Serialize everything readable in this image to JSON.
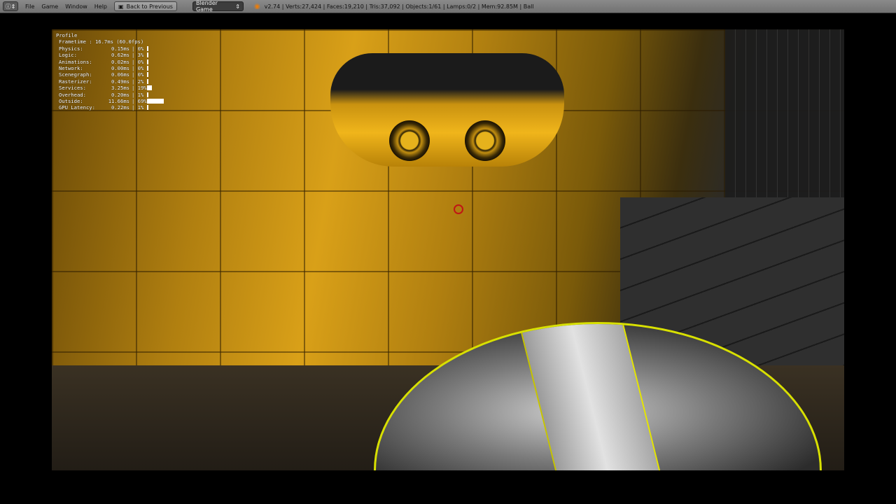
{
  "topbar": {
    "editor_icon": "info-icon",
    "menus": [
      "File",
      "Game",
      "Window",
      "Help"
    ],
    "back_button": "Back to Previous",
    "scene_engine": "Blender Game",
    "stats": "v2.74 | Verts:27,424 | Faces:19,210 | Tris:37,092 | Objects:1/61 | Lamps:0/2 | Mem:92.85M | Ball"
  },
  "profile": {
    "title": "Profile",
    "frametime_label": "Frametime :",
    "frametime_value": "16.7ms (60.0fps)",
    "rows": [
      {
        "label": "Physics:",
        "ms": "0.15ms",
        "pct": "| 0%",
        "fraction": 0.0
      },
      {
        "label": "Logic:",
        "ms": "0.62ms",
        "pct": "| 3%",
        "fraction": 0.03
      },
      {
        "label": "Animations:",
        "ms": "0.02ms",
        "pct": "| 0%",
        "fraction": 0.0
      },
      {
        "label": "Network:",
        "ms": "0.00ms",
        "pct": "| 0%",
        "fraction": 0.0
      },
      {
        "label": "Scenegraph:",
        "ms": "0.06ms",
        "pct": "| 0%",
        "fraction": 0.0
      },
      {
        "label": "Rasterizer:",
        "ms": "0.49ms",
        "pct": "| 2%",
        "fraction": 0.02
      },
      {
        "label": "Services:",
        "ms": "3.25ms",
        "pct": "| 19%",
        "fraction": 0.19
      },
      {
        "label": "Overhead:",
        "ms": "0.20ms",
        "pct": "| 1%",
        "fraction": 0.01
      },
      {
        "label": "Outside:",
        "ms": "11.66ms",
        "pct": "| 69%",
        "fraction": 0.69
      },
      {
        "label": "GPU Latency:",
        "ms": "0.22ms",
        "pct": "| 1%",
        "fraction": 0.01
      }
    ]
  }
}
